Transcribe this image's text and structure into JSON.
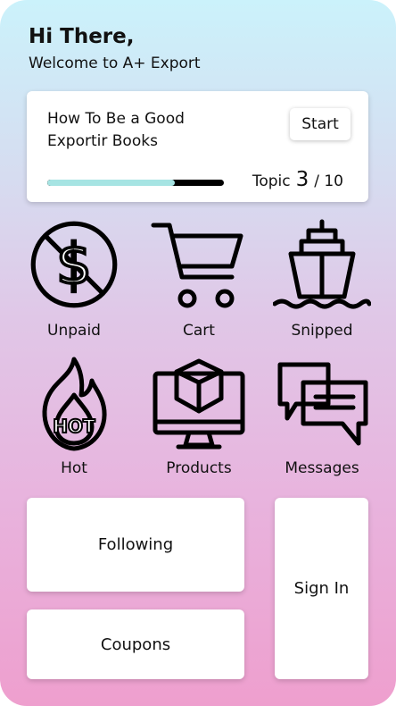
{
  "greeting": {
    "title": "Hi There,",
    "subtitle": "Welcome to A+ Export"
  },
  "course": {
    "title": "How To Be a Good Exportir Books",
    "start_label": "Start",
    "progress": 0.72,
    "topic_label": "Topic",
    "topic_current": "3",
    "topic_total": "/ 10"
  },
  "categories": [
    {
      "label": "Unpaid",
      "icon": "no-dollar-icon"
    },
    {
      "label": "Cart",
      "icon": "cart-icon"
    },
    {
      "label": "Snipped",
      "icon": "ship-icon"
    },
    {
      "label": "Hot",
      "icon": "hot-fire-icon"
    },
    {
      "label": "Products",
      "icon": "monitor-box-icon"
    },
    {
      "label": "Messages",
      "icon": "chat-bubbles-icon"
    }
  ],
  "actions": {
    "following": "Following",
    "coupons": "Coupons",
    "sign_in": "Sign In"
  },
  "colors": {
    "progress_fill": "#a6e4e3",
    "progress_track": "#000000",
    "gradient_top": "#cbf2fb",
    "gradient_bottom": "#ee9fce"
  }
}
